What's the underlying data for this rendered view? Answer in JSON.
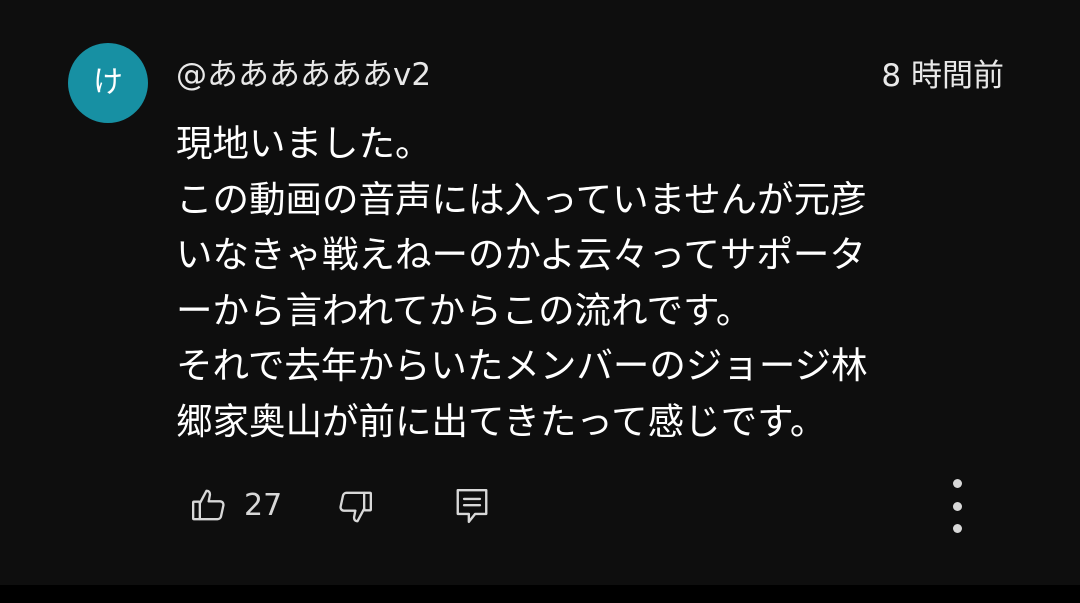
{
  "comment": {
    "avatar_initial": "け",
    "avatar_color": "#1790a3",
    "username": "@ああああああv2",
    "timestamp": "8 時間前",
    "lines": [
      "現地いました。",
      "この動画の音声には入っていませんが元彦",
      "いなきゃ戦えねーのかよ云々ってサポータ",
      "ーから言われてからこの流れです。",
      "それで去年からいたメンバーのジョージ林",
      "郷家奥山が前に出てきたって感じです。"
    ]
  },
  "actions": {
    "like_count": "27",
    "like_icon": "thumbs-up-icon",
    "dislike_icon": "thumbs-down-icon",
    "reply_icon": "comment-reply-icon",
    "more_icon": "more-vertical-icon"
  }
}
